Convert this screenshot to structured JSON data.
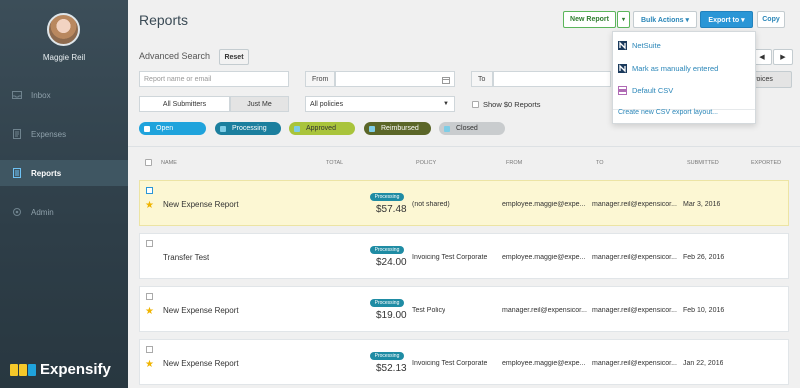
{
  "sidebar": {
    "username": "Maggie Reil",
    "items": [
      {
        "label": "Inbox"
      },
      {
        "label": "Expenses"
      },
      {
        "label": "Reports"
      },
      {
        "label": "Admin"
      }
    ],
    "logo_text": "Expensify"
  },
  "header": {
    "title": "Reports",
    "new_report": "New Report",
    "bulk_actions": "Bulk Actions ▾",
    "export_to": "Export to ▾",
    "copy": "Copy"
  },
  "filters": {
    "advanced_search": "Advanced Search",
    "reset": "Reset",
    "name_placeholder": "Report name or email",
    "from": "From",
    "to": "To",
    "all_submitters": "All Submitters",
    "just_me": "Just Me",
    "policy_select": "All policies",
    "show_zero": "Show $0 Reports",
    "invoices_partial": "Invoices",
    "statuses": [
      {
        "label": "Open",
        "color": "#1fa3dc"
      },
      {
        "label": "Processing",
        "color": "#1c7f9e"
      },
      {
        "label": "Approved",
        "color": "#a9c43b"
      },
      {
        "label": "Reimbursed",
        "color": "#5b6628"
      },
      {
        "label": "Closed",
        "color": "#c9ccce"
      }
    ]
  },
  "table": {
    "headers": [
      "NAME",
      "TOTAL",
      "POLICY",
      "FROM",
      "TO",
      "SUBMITTED",
      "EXPORTED"
    ],
    "rows": [
      {
        "name": "New Expense Report",
        "status": "Processing",
        "total": "$57.48",
        "policy": "(not shared)",
        "from": "employee.maggie@expe...",
        "to": "manager.reil@expensicor...",
        "submitted": "Mar 3, 2016",
        "highlight": true
      },
      {
        "name": "Transfer Test",
        "status": "Processing",
        "total": "$24.00",
        "policy": "Invoicing Test Corporate",
        "from": "employee.maggie@expe...",
        "to": "manager.reil@expensicor...",
        "submitted": "Feb 26, 2016",
        "highlight": false
      },
      {
        "name": "New Expense Report",
        "status": "Processing",
        "total": "$19.00",
        "policy": "Test Policy",
        "from": "manager.reil@expensicor...",
        "to": "manager.reil@expensicor...",
        "submitted": "Feb 10, 2016",
        "highlight": false
      },
      {
        "name": "New Expense Report",
        "status": "Processing",
        "total": "$52.13",
        "policy": "Invoicing Test Corporate",
        "from": "employee.maggie@expe...",
        "to": "manager.reil@expensicor...",
        "submitted": "Jan 22, 2016",
        "highlight": false
      }
    ]
  },
  "export_menu": {
    "items": [
      {
        "label": "NetSuite",
        "icon": "netsuite-icon"
      },
      {
        "label": "Mark as manually entered",
        "icon": "netsuite-icon"
      },
      {
        "label": "Default CSV",
        "icon": "csv-icon"
      }
    ],
    "create_layout": "Create new CSV export layout..."
  }
}
